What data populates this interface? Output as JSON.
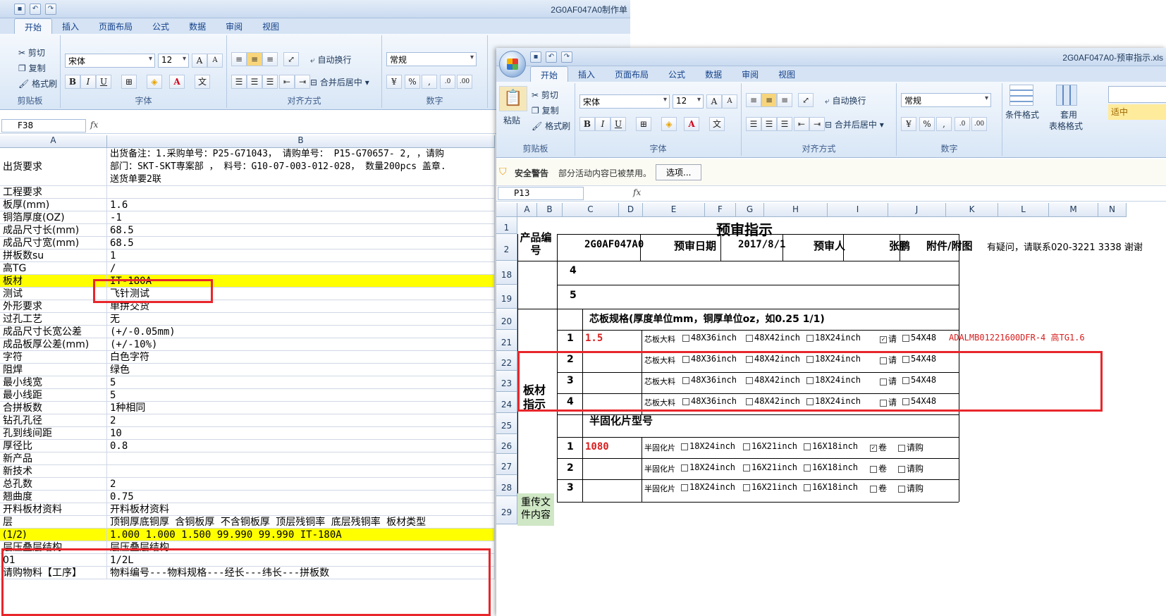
{
  "w1": {
    "title": "2G0AF047A0制作单",
    "tabs": [
      "开始",
      "插入",
      "页面布局",
      "公式",
      "数据",
      "审阅",
      "视图"
    ],
    "clipboard": {
      "cut": "剪切",
      "copy": "复制",
      "painter": "格式刷",
      "paste": "粘贴",
      "label": "剪贴板"
    },
    "font": {
      "name": "宋体",
      "size": "12",
      "label": "字体"
    },
    "align": {
      "wrap": "自动换行",
      "merge": "合并后居中",
      "label": "对齐方式"
    },
    "number": {
      "format": "常规",
      "label": "数字"
    },
    "namebox": "F38",
    "col_a": "A",
    "col_b": "B",
    "rows": [
      {
        "a": "出货要求",
        "b": "出货备注：1.采购单号：P25-G71043，  请购单号： P15-G70657- 2, ，请购",
        "b2": "部门：SKT-SKT専案部 ， 料号：G10-07-003-012-028， 数量200pcs  盖章.",
        "b3": "送货单要2联"
      },
      {
        "a": "工程要求",
        "b": ""
      },
      {
        "a": "板厚(mm)",
        "b": "1.6"
      },
      {
        "a": "铜箔厚度(OZ)",
        "b": "-1"
      },
      {
        "a": "成品尺寸长(mm)",
        "b": "68.5"
      },
      {
        "a": "成品尺寸宽(mm)",
        "b": "68.5"
      },
      {
        "a": "拼板数su",
        "b": "1"
      },
      {
        "a": "高TG",
        "b": "/"
      },
      {
        "a": "板材",
        "b": "IT-180A"
      },
      {
        "a": "测试",
        "b": "飞针测试"
      },
      {
        "a": "外形要求",
        "b": "单拼交货"
      },
      {
        "a": "过孔工艺",
        "b": "无"
      },
      {
        "a": "成品尺寸长宽公差",
        "b": "(+/-0.05mm)"
      },
      {
        "a": "成品板厚公差(mm)",
        "b": "(+/-10%)"
      },
      {
        "a": "字符",
        "b": "白色字符"
      },
      {
        "a": "阻焊",
        "b": "绿色"
      },
      {
        "a": "最小线宽",
        "b": "5"
      },
      {
        "a": "最小线距",
        "b": "5"
      },
      {
        "a": "合拼板数",
        "b": "1种相同"
      },
      {
        "a": "钻孔孔径",
        "b": "2"
      },
      {
        "a": "孔到线间距",
        "b": "10"
      },
      {
        "a": "厚径比",
        "b": "0.8"
      },
      {
        "a": "新产品",
        "b": ""
      },
      {
        "a": "新技术",
        "b": ""
      },
      {
        "a": "总孔数",
        "b": "2"
      },
      {
        "a": "翘曲度",
        "b": "0.75"
      },
      {
        "a": "开料板材资料",
        "b": "开料板材资料"
      },
      {
        "a": "层",
        "b": "顶铜厚底铜厚 含铜板厚 不含铜板厚 顶层残铜率 底层残铜率 板材类型"
      },
      {
        "a": "(1/2)",
        "b": "1.000  1.000   1.500              99.990     99.990      IT-180A"
      },
      {
        "a": "层压叠层结构",
        "b": "层压叠层结构"
      },
      {
        "a": "01",
        "b": "1/2L"
      },
      {
        "a": "请购物料【工序】",
        "b": "物料编号---物料规格---经长---纬长---拼板数"
      }
    ]
  },
  "w2": {
    "title": "2G0AF047A0-预审指示.xls",
    "tabs": [
      "开始",
      "插入",
      "页面布局",
      "公式",
      "数据",
      "审阅",
      "视图"
    ],
    "clipboard": {
      "cut": "剪切",
      "copy": "复制",
      "painter": "格式刷",
      "paste": "粘贴",
      "label": "剪贴板"
    },
    "font": {
      "name": "宋体",
      "size": "12",
      "label": "字体"
    },
    "align": {
      "wrap": "自动换行",
      "merge": "合并后居中",
      "label": "对齐方式"
    },
    "number": {
      "format": "常规",
      "label": "数字"
    },
    "styles": {
      "cond": "条件格式",
      "table": "套用",
      "table2": "表格格式",
      "mid": "适中"
    },
    "security": {
      "warn": "安全警告",
      "msg": "部分活动内容已被禁用。",
      "btn": "选项..."
    },
    "namebox": "P13",
    "cols": [
      "A",
      "B",
      "C",
      "D",
      "E",
      "F",
      "G",
      "H",
      "I",
      "J",
      "K",
      "L",
      "M",
      "N"
    ],
    "rownums": [
      "1",
      "2",
      "18",
      "19",
      "20",
      "21",
      "22",
      "23",
      "24",
      "25",
      "26",
      "27",
      "28",
      "29"
    ],
    "heading": "预审指示",
    "product_label": "产品编号",
    "product_no": "2G0AF047A0",
    "date_label": "预审日期",
    "date": "2017/8/1",
    "reviewer_label": "预审人",
    "reviewer": "张鹏",
    "attach_label": "附件/附图",
    "contact": "有疑问，请联系020-3221 3338 谢谢",
    "r18_num": "4",
    "r19_num": "5",
    "core_title": "芯板规格(厚度单位mm，铜厚单位oz，如0.25 1/1)",
    "board_label": "板材指示",
    "core_rows": [
      {
        "n": "1",
        "val": "1.5",
        "lab": "芯板大料"
      },
      {
        "n": "2",
        "val": "",
        "lab": "芯板大料"
      },
      {
        "n": "3",
        "val": "",
        "lab": "芯板大料"
      },
      {
        "n": "4",
        "val": "",
        "lab": "芯板大料"
      }
    ],
    "core_opts": [
      "48X36inch",
      "48X42inch",
      "18X24inch",
      "请",
      "54X48"
    ],
    "core_note": "ADALMB01221600DFR-4 高TG1.6",
    "prepreg_title": "半固化片型号",
    "prepreg_rows": [
      {
        "n": "1",
        "val": "1080",
        "lab": "半固化片"
      },
      {
        "n": "2",
        "val": "",
        "lab": "半固化片"
      },
      {
        "n": "3",
        "val": "",
        "lab": "半固化片"
      }
    ],
    "prepreg_opts": [
      "18X24inch",
      "16X21inch",
      "16X18inch",
      "卷",
      "请购"
    ],
    "reupload": "重传文件内容"
  }
}
